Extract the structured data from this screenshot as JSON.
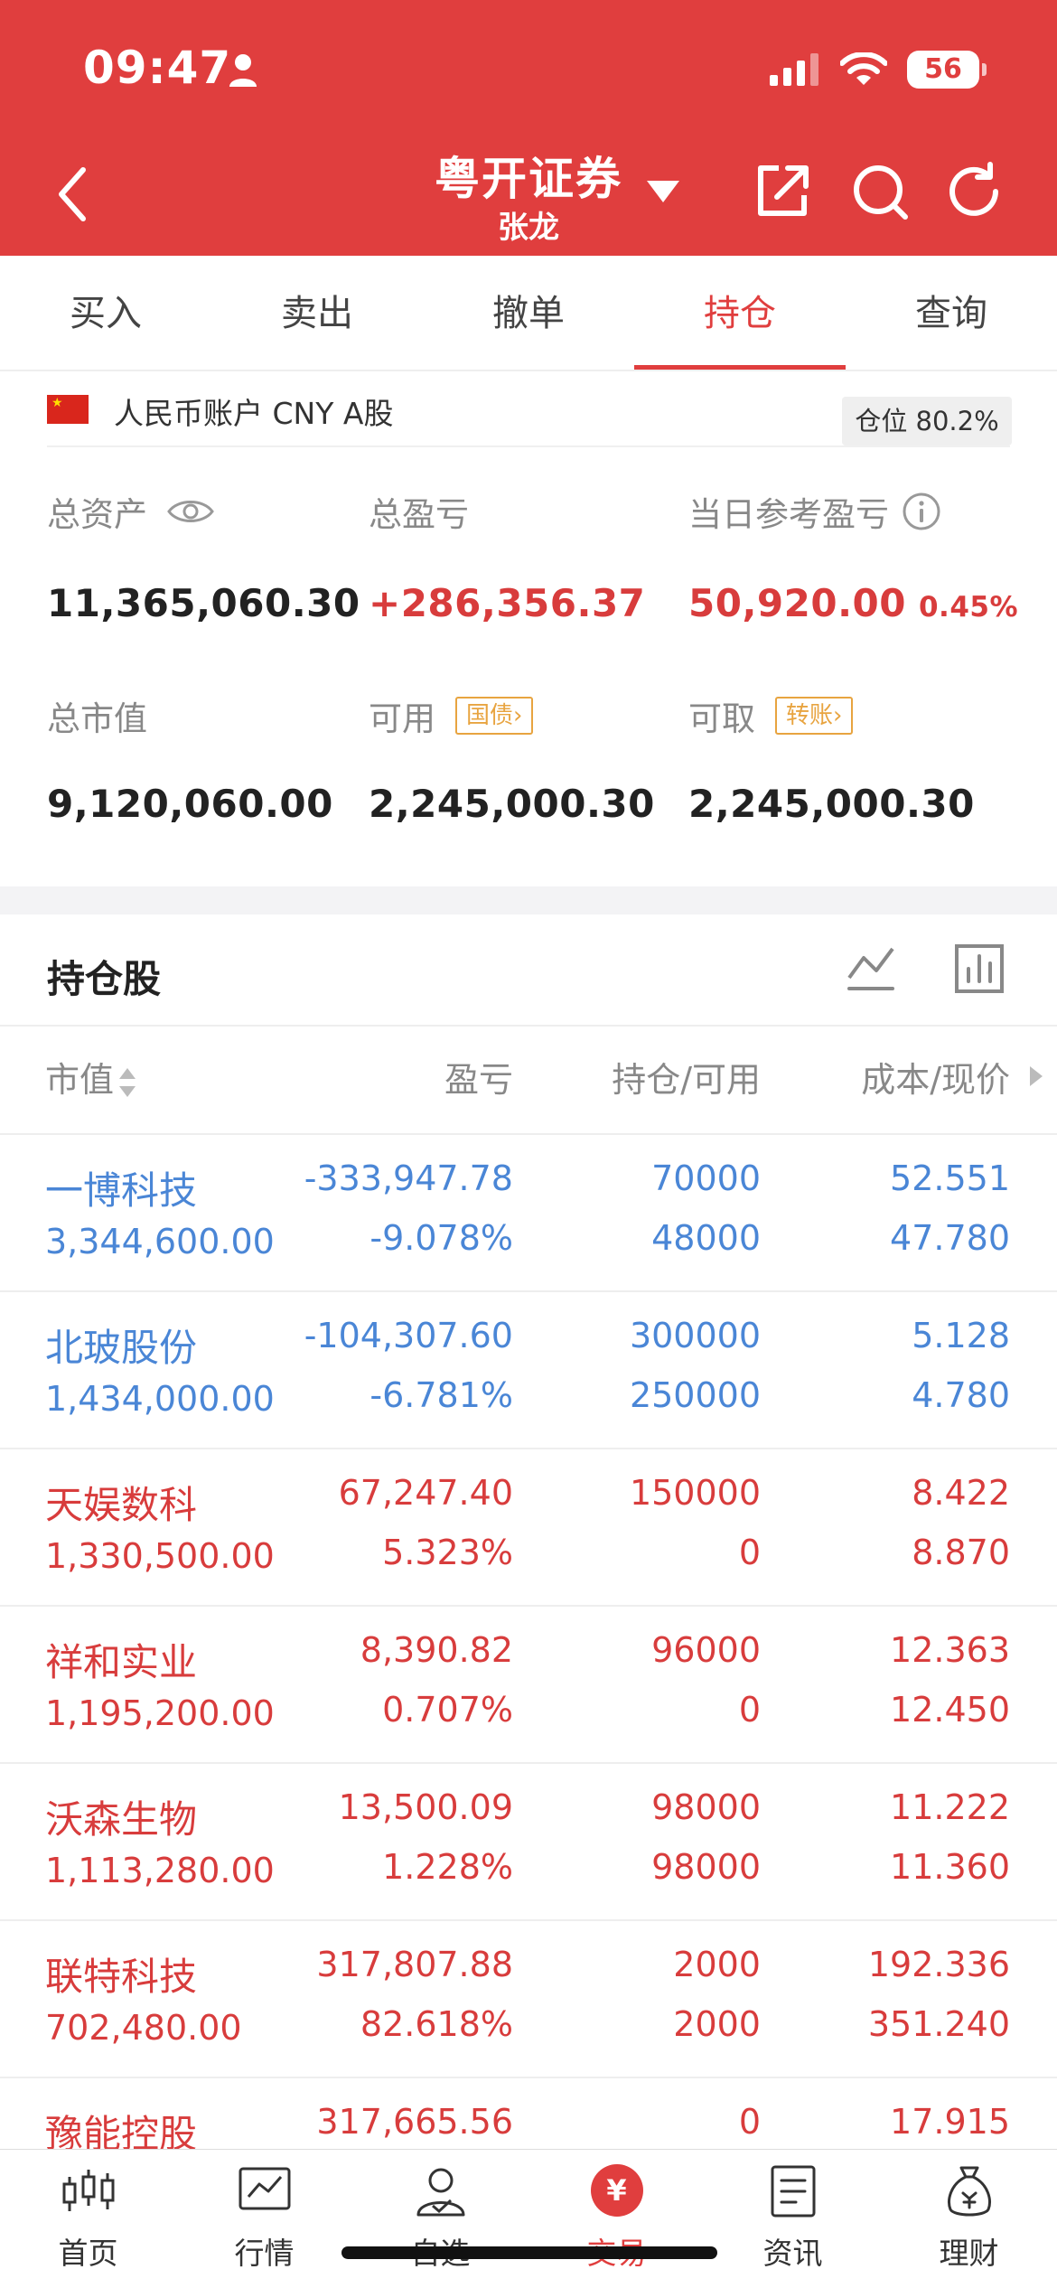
{
  "status": {
    "time": "09:47",
    "battery": "56"
  },
  "header": {
    "title": "粤开证券",
    "subtitle": "张龙"
  },
  "tabs": [
    {
      "label": "买入"
    },
    {
      "label": "卖出"
    },
    {
      "label": "撤单"
    },
    {
      "label": "持仓"
    },
    {
      "label": "查询"
    }
  ],
  "account": {
    "label": "人民币账户 CNY A股",
    "position_label": "仓位 80.2%",
    "total_assets_label": "总资产",
    "total_assets": "11,365,060.30",
    "total_pl_label": "总盈亏",
    "total_pl": "+286,356.37",
    "day_pl_label": "当日参考盈亏",
    "day_pl": "50,920.00",
    "day_pl_pct": "0.45%",
    "market_value_label": "总市值",
    "market_value": "9,120,060.00",
    "available_label": "可用",
    "available_tag": "国债",
    "available": "2,245,000.30",
    "withdrawable_label": "可取",
    "withdrawable_tag": "转账",
    "withdrawable": "2,245,000.30",
    "accent_color": "#e03e3e",
    "tag_color": "#e8a440"
  },
  "holdings": {
    "title": "持仓股",
    "columns": [
      "市值",
      "盈亏",
      "持仓/可用",
      "成本/现价"
    ],
    "rows": [
      {
        "name": "一博科技",
        "market_value": "3,344,600.00",
        "pl": "-333,947.78",
        "pl_pct": "-9.078%",
        "hold": "70000",
        "available": "48000",
        "cost": "52.551",
        "price": "47.780",
        "trend": "down"
      },
      {
        "name": "北玻股份",
        "market_value": "1,434,000.00",
        "pl": "-104,307.60",
        "pl_pct": "-6.781%",
        "hold": "300000",
        "available": "250000",
        "cost": "5.128",
        "price": "4.780",
        "trend": "down"
      },
      {
        "name": "天娱数科",
        "market_value": "1,330,500.00",
        "pl": "67,247.40",
        "pl_pct": "5.323%",
        "hold": "150000",
        "available": "0",
        "cost": "8.422",
        "price": "8.870",
        "trend": "up"
      },
      {
        "name": "祥和实业",
        "market_value": "1,195,200.00",
        "pl": "8,390.82",
        "pl_pct": "0.707%",
        "hold": "96000",
        "available": "0",
        "cost": "12.363",
        "price": "12.450",
        "trend": "up"
      },
      {
        "name": "沃森生物",
        "market_value": "1,113,280.00",
        "pl": "13,500.09",
        "pl_pct": "1.228%",
        "hold": "98000",
        "available": "98000",
        "cost": "11.222",
        "price": "11.360",
        "trend": "up"
      },
      {
        "name": "联特科技",
        "market_value": "702,480.00",
        "pl": "317,807.88",
        "pl_pct": "82.618%",
        "hold": "2000",
        "available": "2000",
        "cost": "192.336",
        "price": "351.240",
        "trend": "up"
      },
      {
        "name": "豫能控股",
        "market_value": "",
        "pl": "317,665.56",
        "pl_pct": "",
        "hold": "0",
        "available": "",
        "cost": "17.915",
        "price": "",
        "trend": "up"
      }
    ],
    "up_color": "#d83c3c",
    "down_color": "#4a86d6"
  },
  "nav": [
    {
      "label": "首页",
      "icon": "candlestick-icon"
    },
    {
      "label": "行情",
      "icon": "chart-icon"
    },
    {
      "label": "自选",
      "icon": "person-check-icon"
    },
    {
      "label": "交易",
      "icon": "yuan-icon",
      "glyph": "¥"
    },
    {
      "label": "资讯",
      "icon": "document-icon"
    },
    {
      "label": "理财",
      "icon": "money-bag-icon"
    }
  ]
}
